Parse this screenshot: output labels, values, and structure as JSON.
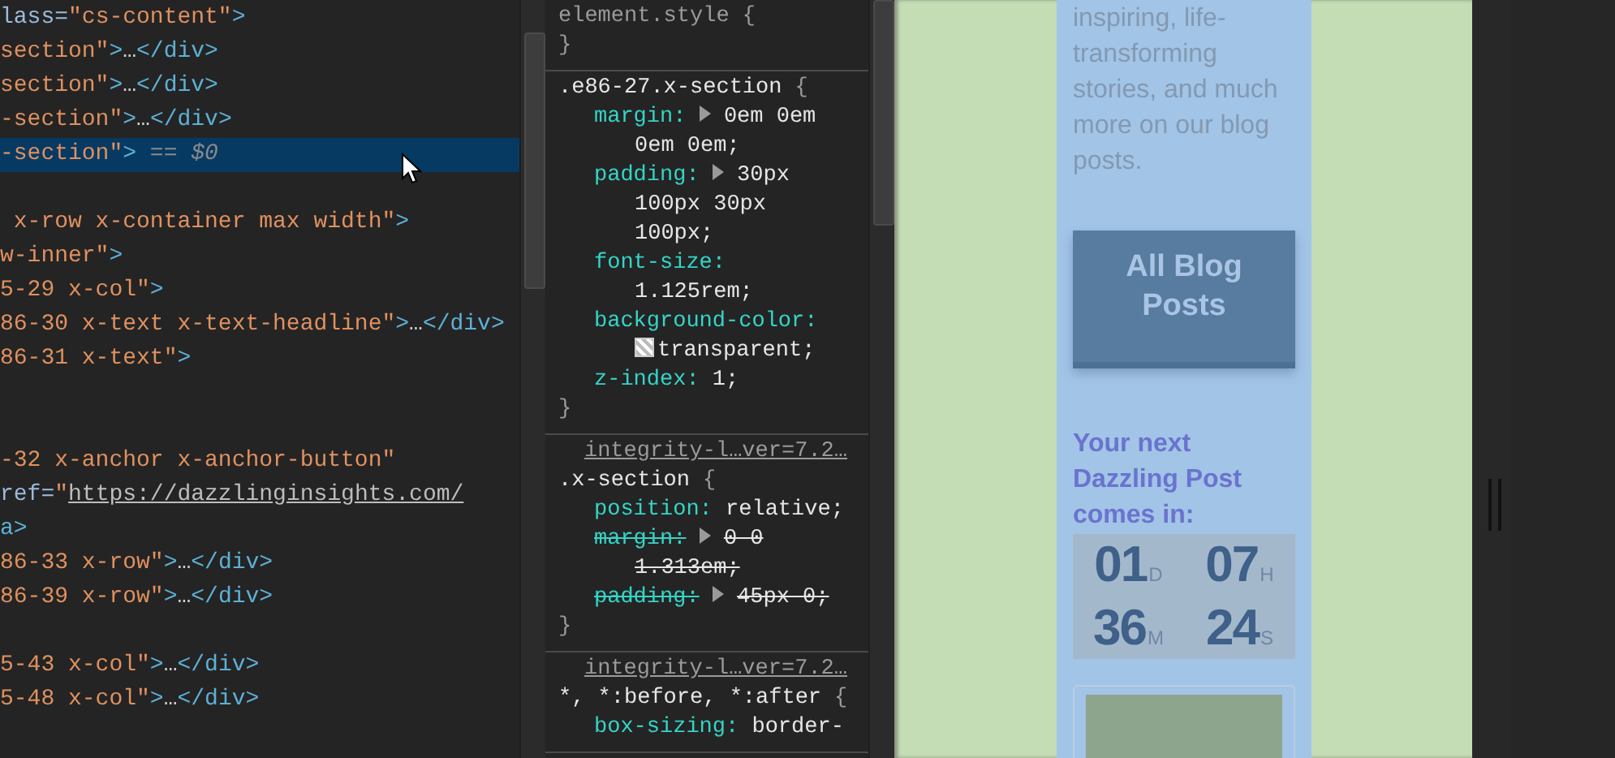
{
  "elements_panel": {
    "lines": [
      {
        "selected": false,
        "segments": [
          {
            "kind": "attr",
            "text": "lass="
          },
          {
            "kind": "value",
            "text": "\"cs-content\""
          },
          {
            "kind": "tag",
            "text": ">"
          }
        ]
      },
      {
        "selected": false,
        "segments": [
          {
            "kind": "value",
            "text": "section\""
          },
          {
            "kind": "tag",
            "text": ">"
          },
          {
            "kind": "ellipsis",
            "text": "…"
          },
          {
            "kind": "tag",
            "text": "</div>"
          }
        ]
      },
      {
        "selected": false,
        "segments": [
          {
            "kind": "value",
            "text": "section\""
          },
          {
            "kind": "tag",
            "text": ">"
          },
          {
            "kind": "ellipsis",
            "text": "…"
          },
          {
            "kind": "tag",
            "text": "</div>"
          }
        ]
      },
      {
        "selected": false,
        "segments": [
          {
            "kind": "value",
            "text": "-section\""
          },
          {
            "kind": "tag",
            "text": ">"
          },
          {
            "kind": "ellipsis",
            "text": "…"
          },
          {
            "kind": "tag",
            "text": "</div>"
          }
        ]
      },
      {
        "selected": true,
        "segments": [
          {
            "kind": "value",
            "text": "-section\""
          },
          {
            "kind": "tag",
            "text": ">"
          },
          {
            "kind": "marker",
            "text": " == $0"
          }
        ]
      },
      {
        "selected": false
      },
      {
        "selected": false,
        "segments": [
          {
            "kind": "value",
            "text": " x-row x-container max width\""
          },
          {
            "kind": "tag",
            "text": ">"
          }
        ]
      },
      {
        "selected": false,
        "segments": [
          {
            "kind": "value",
            "text": "w-inner\""
          },
          {
            "kind": "tag",
            "text": ">"
          }
        ]
      },
      {
        "selected": false,
        "segments": [
          {
            "kind": "value",
            "text": "5-29 x-col\""
          },
          {
            "kind": "tag",
            "text": ">"
          }
        ]
      },
      {
        "selected": false,
        "segments": [
          {
            "kind": "value",
            "text": "86-30 x-text x-text-headline\""
          },
          {
            "kind": "tag",
            "text": ">"
          },
          {
            "kind": "ellipsis",
            "text": "…"
          },
          {
            "kind": "tag",
            "text": "</div>"
          }
        ]
      },
      {
        "selected": false,
        "segments": [
          {
            "kind": "value",
            "text": "86-31 x-text\""
          },
          {
            "kind": "tag",
            "text": ">"
          }
        ]
      },
      {
        "selected": false
      },
      {
        "selected": false
      },
      {
        "selected": false,
        "segments": [
          {
            "kind": "value",
            "text": "-32 x-anchor x-anchor-button\""
          }
        ]
      },
      {
        "selected": false,
        "segments": [
          {
            "kind": "attr",
            "text": "ref="
          },
          {
            "kind": "value",
            "text": "\""
          },
          {
            "kind": "link",
            "text": "https://dazzlinginsights.com/"
          }
        ]
      },
      {
        "selected": false,
        "segments": [
          {
            "kind": "tag",
            "text": "a>"
          }
        ]
      },
      {
        "selected": false,
        "segments": [
          {
            "kind": "value",
            "text": "86-33 x-row\""
          },
          {
            "kind": "tag",
            "text": ">"
          },
          {
            "kind": "ellipsis",
            "text": "…"
          },
          {
            "kind": "tag",
            "text": "</div>"
          }
        ]
      },
      {
        "selected": false,
        "segments": [
          {
            "kind": "value",
            "text": "86-39 x-row\""
          },
          {
            "kind": "tag",
            "text": ">"
          },
          {
            "kind": "ellipsis",
            "text": "…"
          },
          {
            "kind": "tag",
            "text": "</div>"
          }
        ]
      },
      {
        "selected": false
      },
      {
        "selected": false,
        "segments": [
          {
            "kind": "value",
            "text": "5-43 x-col\""
          },
          {
            "kind": "tag",
            "text": ">"
          },
          {
            "kind": "ellipsis",
            "text": "…"
          },
          {
            "kind": "tag",
            "text": "</div>"
          }
        ]
      },
      {
        "selected": false,
        "segments": [
          {
            "kind": "value",
            "text": "5-48 x-col\""
          },
          {
            "kind": "tag",
            "text": ">"
          },
          {
            "kind": "ellipsis",
            "text": "…"
          },
          {
            "kind": "tag",
            "text": "</div>"
          }
        ]
      }
    ]
  },
  "styles_panel": {
    "rules": [
      {
        "kind": "inline",
        "selector": "element.style",
        "brace": "{",
        "close": "}"
      },
      {
        "kind": "matched",
        "selector": ".e86-27.x-section",
        "brace": "{",
        "close": "}",
        "declarations": [
          {
            "property": "margin:",
            "value": "0em 0em 0em 0em;",
            "expandable": true,
            "struck": false
          },
          {
            "property": "padding:",
            "value": "30px 100px 30px 100px;",
            "expandable": true,
            "struck": false
          },
          {
            "property": "font-size:",
            "value": "1.125rem;",
            "expandable": false,
            "struck": false
          },
          {
            "property": "background-color:",
            "value": "transparent;",
            "expandable": false,
            "struck": false,
            "swatch": true
          },
          {
            "property": "z-index:",
            "value": "1;",
            "expandable": false,
            "struck": false
          }
        ]
      },
      {
        "kind": "matched",
        "source": "integrity-l…ver=7.2…",
        "selector": ".x-section",
        "brace": "{",
        "close": "}",
        "declarations": [
          {
            "property": "position:",
            "value": "relative;",
            "expandable": false,
            "struck": false
          },
          {
            "property": "margin:",
            "value": "0 0 1.313em;",
            "expandable": true,
            "struck": true
          },
          {
            "property": "padding:",
            "value": "45px 0;",
            "expandable": true,
            "struck": true
          }
        ]
      },
      {
        "kind": "matched",
        "source": "integrity-l…ver=7.2…",
        "selector": "*, *:before, *:after",
        "brace": "{",
        "declarations": [
          {
            "property": "box-sizing:",
            "value": "border-",
            "expandable": false,
            "struck": false
          }
        ]
      }
    ]
  },
  "page_preview": {
    "paragraph": "inspiring, life-transforming stories, and much more on our blog posts.",
    "button": "All Blog Posts",
    "countdown_heading": "Your next Dazzling Post comes in:",
    "countdown": [
      {
        "value": "01",
        "unit": "D"
      },
      {
        "value": "07",
        "unit": "H"
      },
      {
        "value": "36",
        "unit": "M"
      },
      {
        "value": "24",
        "unit": "S"
      }
    ]
  }
}
